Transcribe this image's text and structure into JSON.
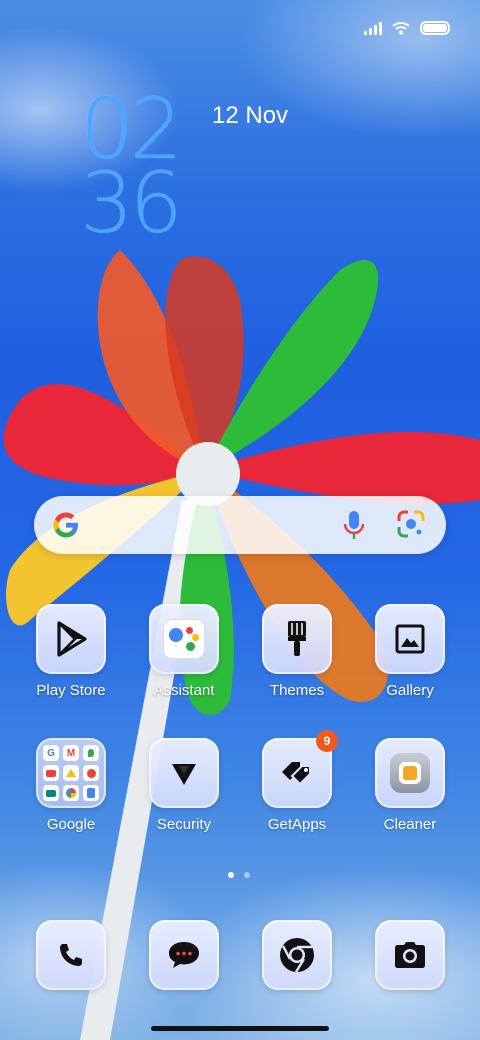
{
  "status_bar": {
    "battery_level": 1.0
  },
  "clock": {
    "hours": "02",
    "minutes": "36",
    "date": "12 Nov"
  },
  "search": {
    "brand": "Google"
  },
  "apps": [
    {
      "label": "Play Store",
      "icon": "play-store-icon"
    },
    {
      "label": "Assistant",
      "icon": "assistant-icon"
    },
    {
      "label": "Themes",
      "icon": "paintbrush-icon"
    },
    {
      "label": "Gallery",
      "icon": "gallery-icon"
    },
    {
      "label": "Google",
      "icon": "google-folder-icon"
    },
    {
      "label": "Security",
      "icon": "security-icon"
    },
    {
      "label": "GetApps",
      "icon": "getapps-icon",
      "badge": "9"
    },
    {
      "label": "Cleaner",
      "icon": "cleaner-icon"
    }
  ],
  "dock": [
    {
      "icon": "phone-icon"
    },
    {
      "icon": "messages-icon"
    },
    {
      "icon": "chrome-icon"
    },
    {
      "icon": "camera-icon"
    }
  ],
  "pages": {
    "current": 1,
    "total": 2
  },
  "colors": {
    "clock": "#4aa6ff",
    "badge": "#f05a1e",
    "tile": "#dfe5fd"
  }
}
